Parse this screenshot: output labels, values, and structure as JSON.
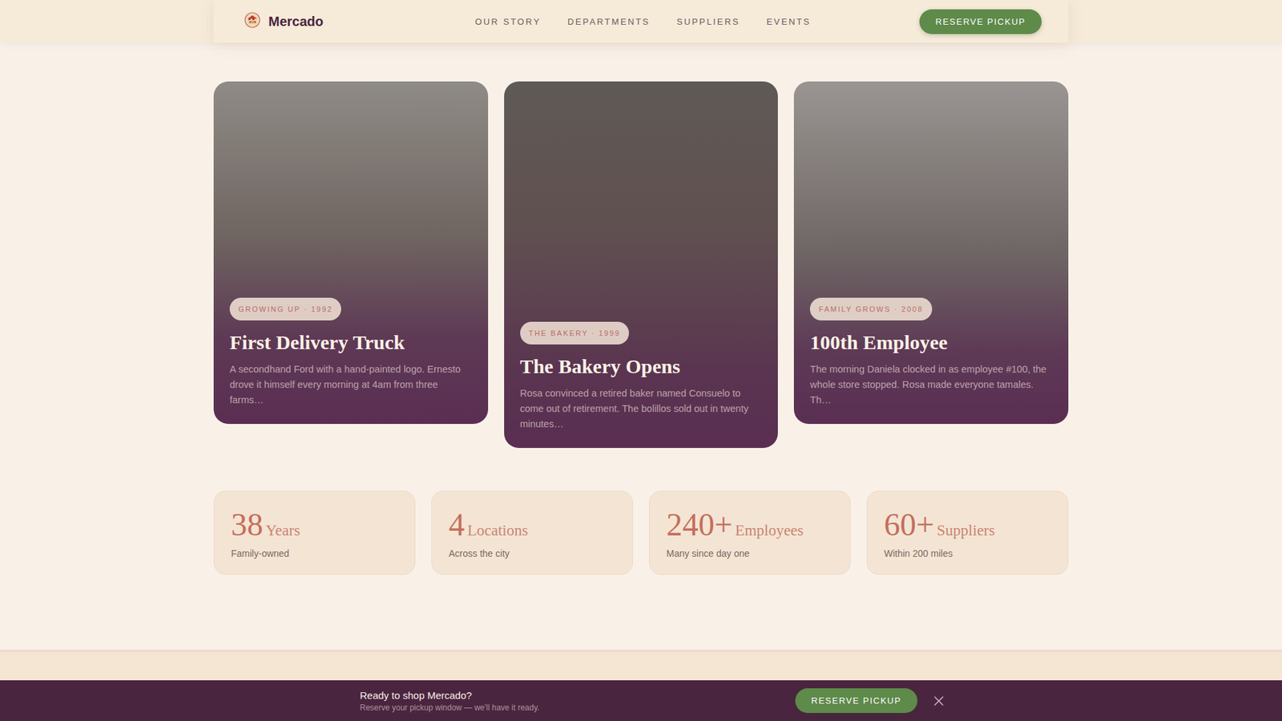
{
  "header": {
    "brand": "Mercado",
    "nav": [
      "OUR STORY",
      "DEPARTMENTS",
      "SUPPLIERS",
      "EVENTS"
    ],
    "cta": "RESERVE PICKUP"
  },
  "milestones": [
    {
      "tag": "GROWING UP · 1992",
      "title": "First Delivery Truck",
      "text": "A secondhand Ford with a hand-painted logo. Ernesto drove it himself every morning at 4am from three farms…"
    },
    {
      "tag": "THE BAKERY · 1999",
      "title": "The Bakery Opens",
      "text": "Rosa convinced a retired baker named Consuelo to come out of retirement. The bolillos sold out in twenty minutes…"
    },
    {
      "tag": "FAMILY GROWS · 2008",
      "title": "100th Employee",
      "text": "The morning Daniela clocked in as employee #100, the whole store stopped. Rosa made everyone tamales. Th…"
    }
  ],
  "stats": [
    {
      "value": "38",
      "unit": "Years",
      "note": "Family-owned"
    },
    {
      "value": "4",
      "unit": "Locations",
      "note": "Across the city"
    },
    {
      "value": "240+",
      "unit": "Employees",
      "note": "Many since day one"
    },
    {
      "value": "60+",
      "unit": "Suppliers",
      "note": "Within 200 miles"
    }
  ],
  "banner": {
    "title": "Ready to shop Mercado?",
    "subtitle": "Reserve your pickup window — we'll have it ready.",
    "cta": "RESERVE PICKUP"
  }
}
